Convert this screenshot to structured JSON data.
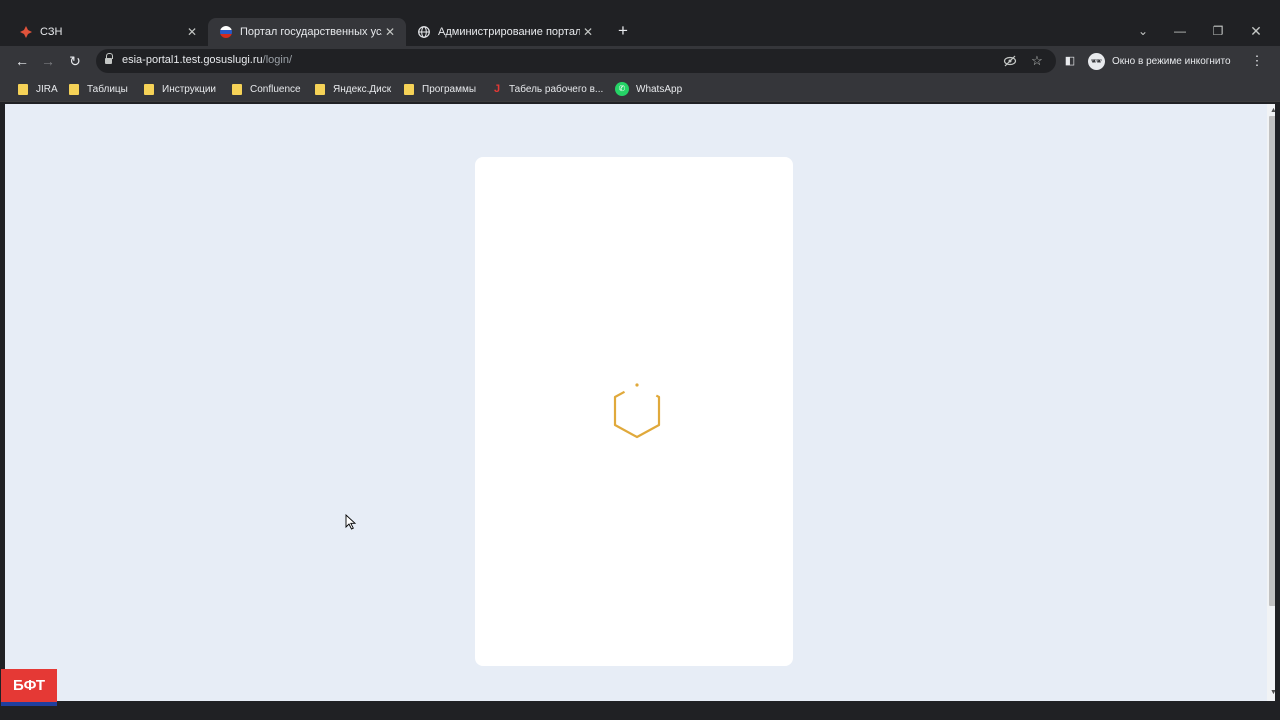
{
  "browser": {
    "tabs": [
      {
        "title": "СЗН",
        "favicon": "ornament-icon",
        "active": false
      },
      {
        "title": "Портал государственных услуг",
        "favicon": "russia-flag-icon",
        "active": true
      },
      {
        "title": "Администрирование портала Р",
        "favicon": "globe-icon",
        "active": false
      }
    ],
    "address_bar": {
      "domain": "esia-portal1.test.gosuslugi.ru",
      "path": "/login/"
    },
    "incognito_label": "Окно в режиме инкогнито",
    "bookmarks": [
      {
        "label": "JIRA",
        "icon": "folder-icon"
      },
      {
        "label": "Таблицы",
        "icon": "folder-icon"
      },
      {
        "label": "Инструкции",
        "icon": "folder-icon"
      },
      {
        "label": "Confluence",
        "icon": "folder-icon"
      },
      {
        "label": "Яндекс.Диск",
        "icon": "folder-icon"
      },
      {
        "label": "Программы",
        "icon": "folder-icon"
      },
      {
        "label": "Табель рабочего в...",
        "icon": "j-app-icon"
      },
      {
        "label": "WhatsApp",
        "icon": "whatsapp-icon"
      }
    ]
  },
  "page": {
    "state": "loading",
    "spinner_icon": "hexagon-spinner-icon",
    "spinner_color": "#e0a93b",
    "background_color": "#e7edf6"
  },
  "overlay": {
    "logo_text": "БФТ",
    "logo_color": "#e53935"
  }
}
